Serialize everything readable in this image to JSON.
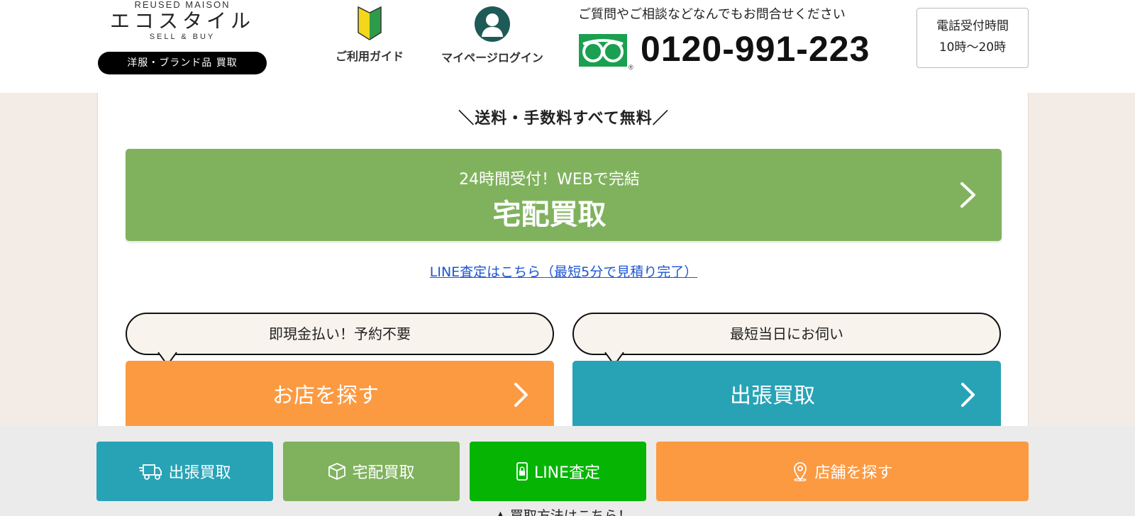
{
  "header": {
    "logo_top": "REUSED MAISON",
    "logo_main": "エコスタイル",
    "logo_sub": "SELL & BUY",
    "logo_tagline": "洋服・ブランド品 買取",
    "nav_guide_label": "ご利用ガイド",
    "nav_mypage_label": "マイページログイン",
    "phone_caption": "ご質問やご相談などなんでもお問合せください",
    "phone_number": "0120-991-223",
    "hours_title": "電話受付時間",
    "hours_value": "10時～20時"
  },
  "main": {
    "free_title": "＼送料・手数料すべて無料／",
    "takuhai_sub": "24時間受付！WEBで完結",
    "takuhai_label": "宅配買取",
    "line_link": "LINE査定はこちら（最短5分で見積り完了）",
    "bubble_left": "即現金払い！予約不要",
    "bubble_right": "最短当日にお伺い",
    "store_label": "お店を探す",
    "shucho_label": "出張買取"
  },
  "bottom_bar": {
    "shucho": "出張買取",
    "takuhai": "宅配買取",
    "line": "LINE査定",
    "store": "店舗を探す",
    "note": "▲ 買取方法はこちら！"
  },
  "colors": {
    "green": "#80b25e",
    "orange": "#fc9a42",
    "teal": "#28a3b6",
    "line_green": "#06b504",
    "dark_teal": "#1e5a58"
  },
  "icons": [
    "beginner-mark-icon",
    "user-icon",
    "freedial-icon",
    "chevron-right-icon",
    "truck-icon",
    "box-icon",
    "phone-lock-icon",
    "map-pin-icon"
  ]
}
